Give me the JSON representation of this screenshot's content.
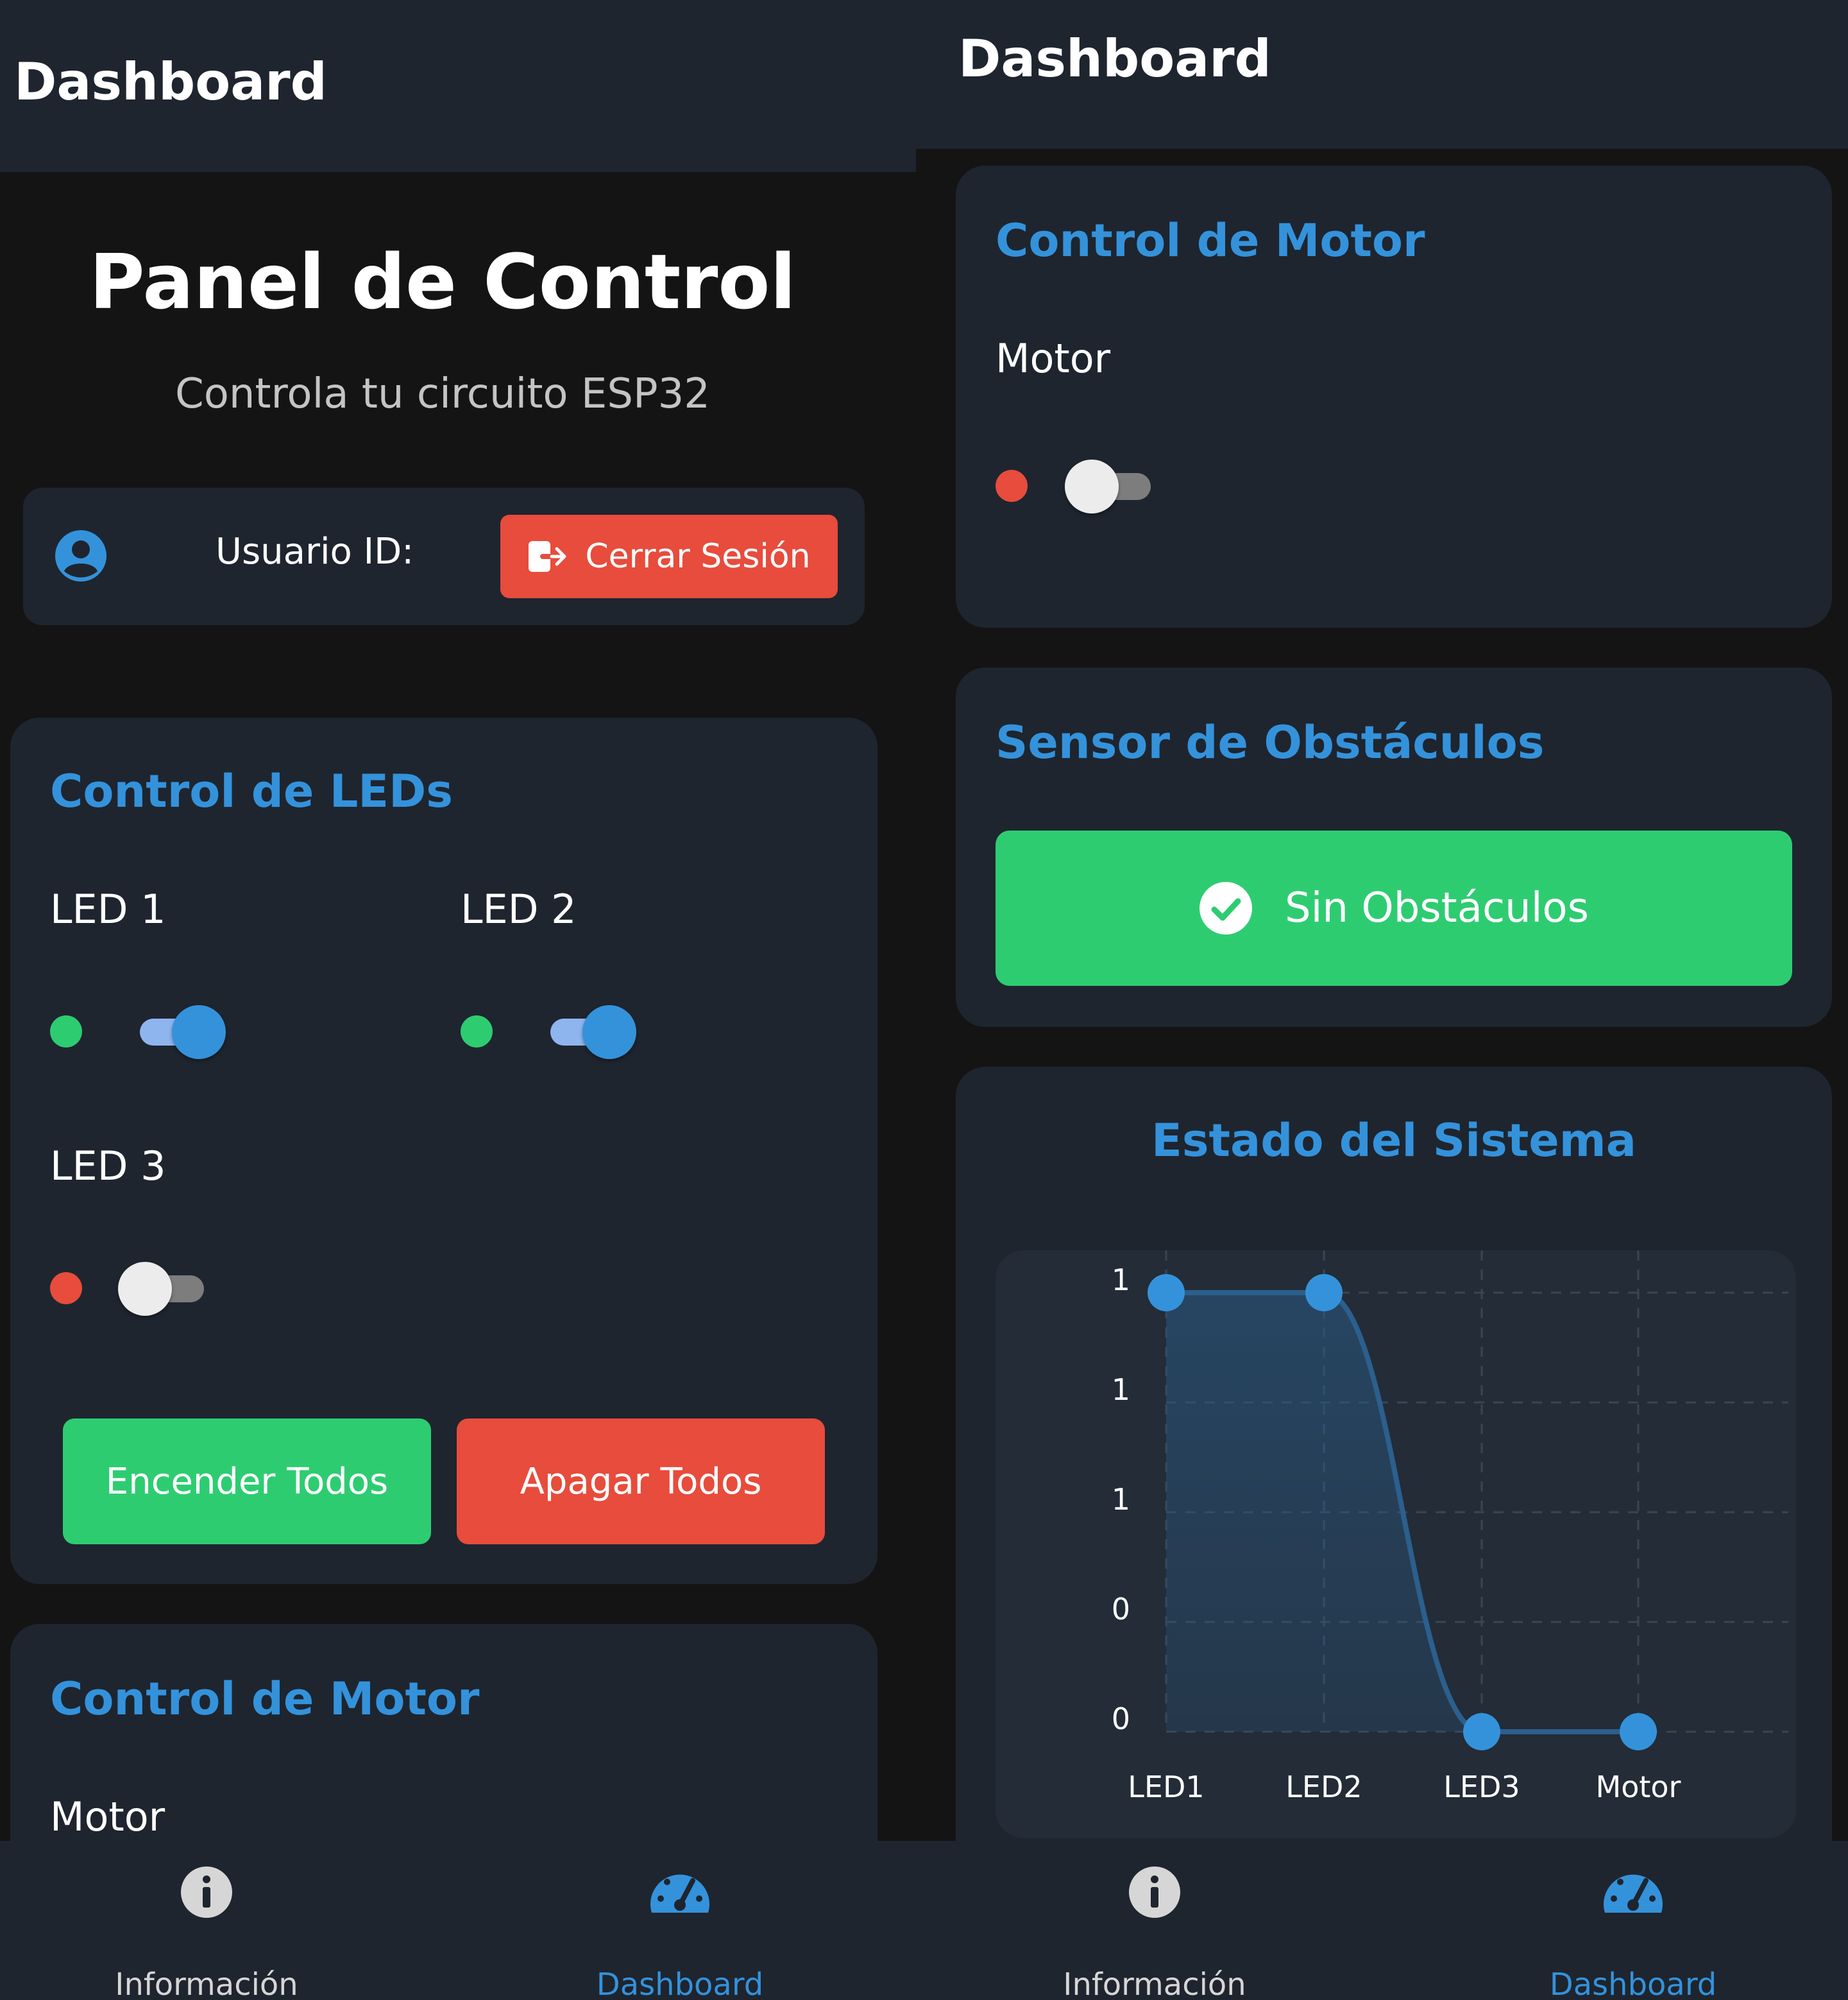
{
  "left": {
    "appbar_title": "Dashboard",
    "panel": {
      "title": "Panel de Control",
      "subtitle": "Controla tu circuito ESP32"
    },
    "user_bar": {
      "label": "Usuario ID:",
      "logout_label": "Cerrar Sesión"
    },
    "leds_card": {
      "title": "Control de LEDs",
      "leds": [
        {
          "label": "LED 1",
          "on": true
        },
        {
          "label": "LED 2",
          "on": true
        },
        {
          "label": "LED 3",
          "on": false
        }
      ],
      "all_on_label": "Encender Todos",
      "all_off_label": "Apagar Todos"
    },
    "motor_card": {
      "title": "Control de Motor",
      "motor_label": "Motor"
    }
  },
  "right": {
    "appbar_title": "Dashboard",
    "motor_card": {
      "title": "Control de Motor",
      "motor_label": "Motor",
      "motor_on": false
    },
    "sensor_card": {
      "title": "Sensor de Obstáculos",
      "status_label": "Sin Obstáculos"
    },
    "chart_card": {
      "title": "Estado del Sistema"
    }
  },
  "bottom_nav": [
    {
      "label": "Información",
      "icon": "info-icon",
      "active": false
    },
    {
      "label": "Dashboard",
      "icon": "speedometer-icon",
      "active": true
    }
  ],
  "colors": {
    "accent": "#3492db",
    "on": "#2ecc71",
    "off": "#e74c3c",
    "card": "#1e252f",
    "background": "#141414"
  },
  "chart_data": {
    "type": "line",
    "title": "Estado del Sistema",
    "categories": [
      "LED1",
      "LED2",
      "LED3",
      "Motor"
    ],
    "values": [
      1,
      1,
      0,
      0
    ],
    "y_tick_labels": [
      "1",
      "1",
      "1",
      "0",
      "0"
    ],
    "ylim": [
      0,
      1
    ],
    "grid": true,
    "area_fill": true,
    "smooth": true
  }
}
